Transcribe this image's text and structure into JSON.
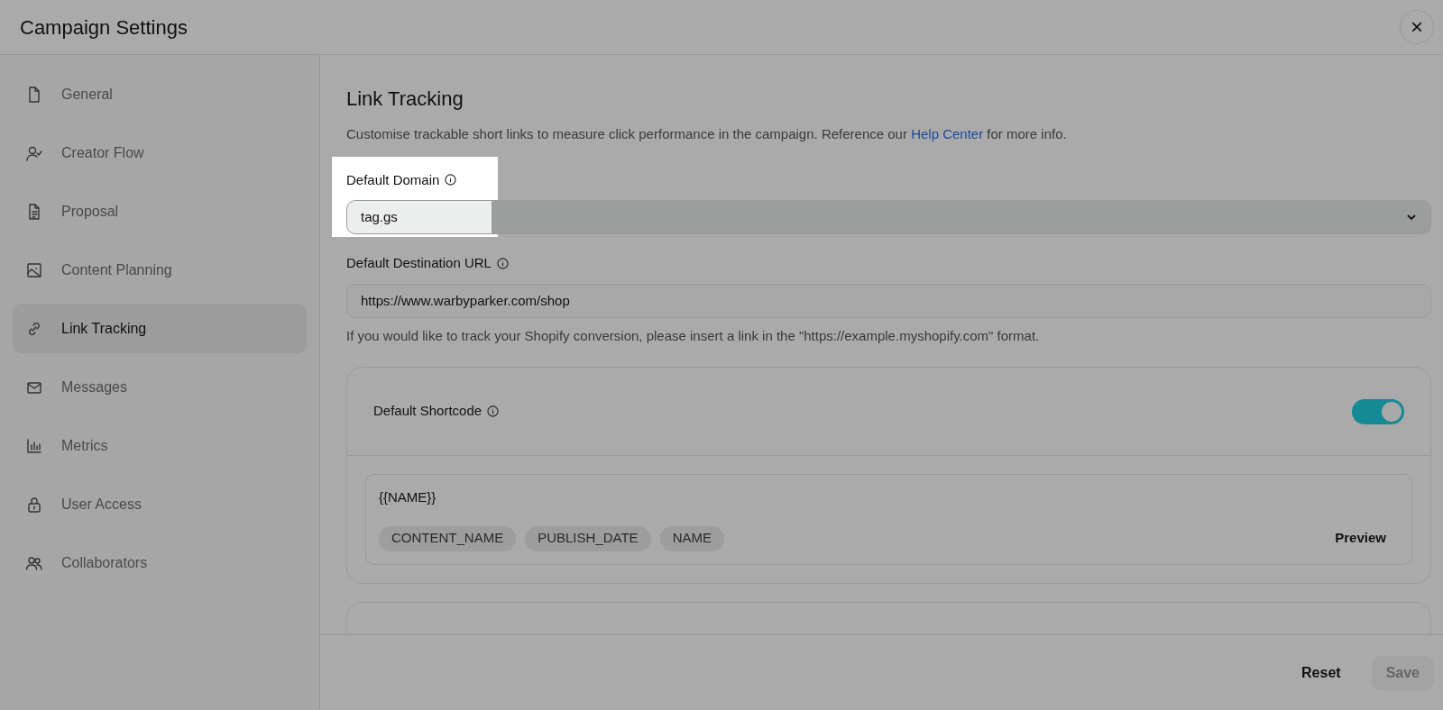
{
  "window": {
    "title": "Campaign Settings",
    "close": "×"
  },
  "sidebar": {
    "items": [
      {
        "label": "General",
        "selected": false
      },
      {
        "label": "Creator Flow",
        "selected": false
      },
      {
        "label": "Proposal",
        "selected": false
      },
      {
        "label": "Content Planning",
        "selected": false
      },
      {
        "label": "Link Tracking",
        "selected": true
      },
      {
        "label": "Messages",
        "selected": false
      },
      {
        "label": "Metrics",
        "selected": false
      },
      {
        "label": "User Access",
        "selected": false
      },
      {
        "label": "Collaborators",
        "selected": false
      }
    ]
  },
  "content": {
    "title": "Link Tracking",
    "description": "Customise trackable short links to measure click performance in the campaign. Reference our ",
    "description_link": "Help Center",
    "description_end": " for more info.",
    "default_domain": {
      "label": "Default Domain",
      "value": "tag.gs",
      "highlighted": true
    },
    "destination": {
      "label": "Default Destination URL",
      "value": "https://www.warbyparker.com/shop",
      "hint": "If you would like to track your Shopify conversion, please insert a link in the \"https://example.myshopify.com\" format."
    },
    "shortcode": {
      "label": "Default Shortcode",
      "on": true,
      "value": "{{NAME}}",
      "chips": [
        "CONTENT_NAME",
        "PUBLISH_DATE",
        "NAME"
      ],
      "preview": "Preview"
    }
  },
  "footer": {
    "reset": "Reset",
    "save": "Save",
    "save_disabled": true
  }
}
